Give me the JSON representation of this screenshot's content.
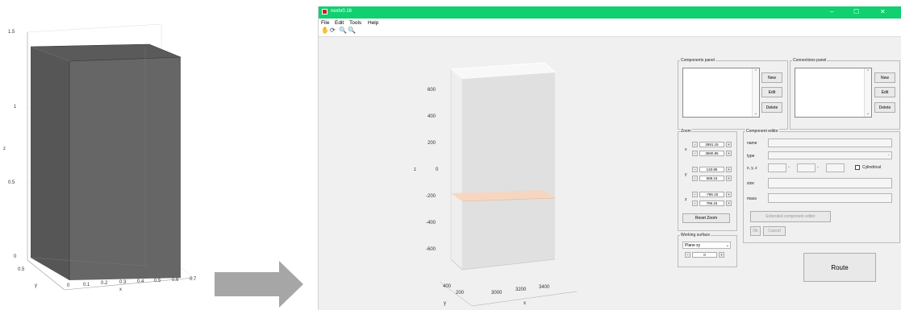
{
  "left_figure": {
    "z_ticks": [
      "1.5",
      "1",
      "0.5",
      "0"
    ],
    "x_ticks": [
      "0",
      "0.1",
      "0.2",
      "0.3",
      "0.4",
      "0.5",
      "0.6",
      "0.7"
    ],
    "y_ticks": [
      "0.5"
    ],
    "xlabel": "x",
    "ylabel": "y",
    "zlabel": "z"
  },
  "window": {
    "title": "nextv0.16",
    "minimize": "–",
    "maximize": "☐",
    "close": "✕"
  },
  "menu": [
    "File",
    "Edit",
    "Tools",
    "Help"
  ],
  "toolbar_icons": [
    "pan-icon",
    "rotate-icon",
    "zoom-in-icon",
    "zoom-out-icon"
  ],
  "plot": {
    "z_ticks": [
      "600",
      "400",
      "200",
      "0",
      "-200",
      "-400",
      "-600"
    ],
    "zlabel": "z",
    "y_ticks": [
      "400",
      "200"
    ],
    "x_ticks": [
      "3000",
      "3200",
      "3400"
    ],
    "xlabel": "x",
    "ylabel": "y"
  },
  "components_panel": {
    "title": "Components panel",
    "new": "New",
    "edit": "Edit",
    "delete": "Delete"
  },
  "connections_panel": {
    "title": "Connections panel",
    "new": "New",
    "edit": "Edit",
    "delete": "Delete"
  },
  "zoom": {
    "title": "Zoom",
    "x_label": "x",
    "y_label": "y",
    "z_label": "z",
    "x_min": "2891.15",
    "x_max": "3580.85",
    "y_min": "133.85",
    "y_max": "588.15",
    "z_min": "-786.15",
    "z_max": "786.15",
    "minus": "-",
    "plus": "+",
    "reset": "Reset Zoom"
  },
  "working_surface": {
    "title": "Working surface",
    "selected": "Plane xy",
    "value": "0"
  },
  "component_editor": {
    "title": "Component editor",
    "name_label": "name",
    "type_label": "type",
    "xyz_label": "x, y, z",
    "cylindrical_label": "Cylindrical",
    "size_label": "size",
    "mass_label": "mass",
    "extended_button": "Extended component editor",
    "ok_button": "Ok",
    "cancel_button": "Cancel"
  },
  "route_button": "Route",
  "colors": {
    "titlebar": "#10d070",
    "plane": "#f5d2b8"
  }
}
